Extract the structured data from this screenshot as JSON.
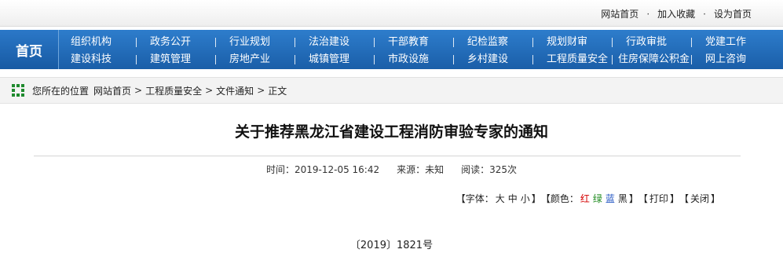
{
  "top_links": {
    "home": "网站首页",
    "favorite": "加入收藏",
    "set_home": "设为首页",
    "dot": "·"
  },
  "nav": {
    "home_label": "首页",
    "row1": [
      "组织机构",
      "政务公开",
      "行业规划",
      "法治建设",
      "干部教育",
      "纪检监察",
      "规划财审",
      "行政审批",
      "党建工作"
    ],
    "row2": [
      "建设科技",
      "建筑管理",
      "房地产业",
      "城镇管理",
      "市政设施",
      "乡村建设",
      "工程质量安全",
      "住房保障公积金",
      "网上咨询"
    ]
  },
  "breadcrumb": {
    "prefix": "您所在的位置",
    "items": [
      "网站首页",
      "工程质量安全",
      "文件通知",
      "正文"
    ],
    "sep": ">"
  },
  "article": {
    "title": "关于推荐黑龙江省建设工程消防审验专家的通知",
    "time": "时间：2019-12-05 16:42",
    "source": "来源：未知",
    "reads": "阅读：325次",
    "doc_number": "〔2019〕1821号"
  },
  "tools": {
    "font_label": "字体：",
    "font_big": "大",
    "font_mid": "中",
    "font_small": "小",
    "color_label": "颜色：",
    "color_red": "红",
    "color_green": "绿",
    "color_blue": "蓝",
    "color_black": "黑",
    "print": "打印",
    "close": "关闭",
    "open_bracket": "【",
    "close_bracket": "】"
  },
  "colors": {
    "nav_blue": "#1a5ea8",
    "breadcrumb_icon": "#1f8a2e",
    "red": "#d40000",
    "green": "#1e8a1e",
    "blue": "#1a4fc0"
  }
}
